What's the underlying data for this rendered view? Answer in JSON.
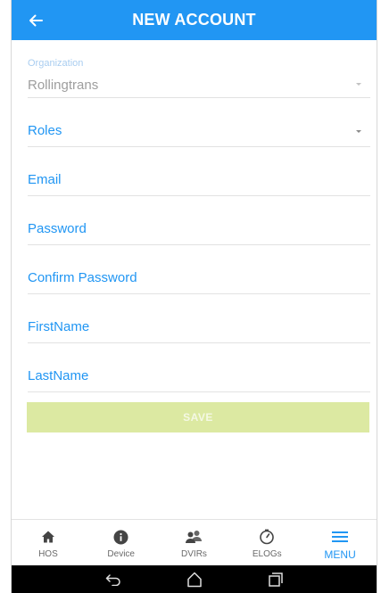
{
  "header": {
    "title": "NEW ACCOUNT",
    "back_icon": "arrow-left-icon"
  },
  "form": {
    "organization": {
      "label": "Organization",
      "value": "Rollingtrans"
    },
    "roles": {
      "label": "Roles",
      "value": ""
    },
    "email": {
      "label": "Email"
    },
    "password": {
      "label": "Password"
    },
    "confirm_password": {
      "label": "Confirm Password"
    },
    "first_name": {
      "label": "FirstName"
    },
    "last_name": {
      "label": "LastName"
    },
    "save_label": "SAVE"
  },
  "tabs": [
    {
      "label": "HOS",
      "icon": "home-icon"
    },
    {
      "label": "Device",
      "icon": "info-icon"
    },
    {
      "label": "DVIRs",
      "icon": "users-icon"
    },
    {
      "label": "ELOGs",
      "icon": "timer-icon"
    },
    {
      "label": "MENU",
      "icon": "hamburger-menu-icon",
      "active": true
    }
  ],
  "colors": {
    "primary": "#2196f3",
    "save_disabled": "#dce9a2",
    "label_faded": "#a9cdf0"
  }
}
